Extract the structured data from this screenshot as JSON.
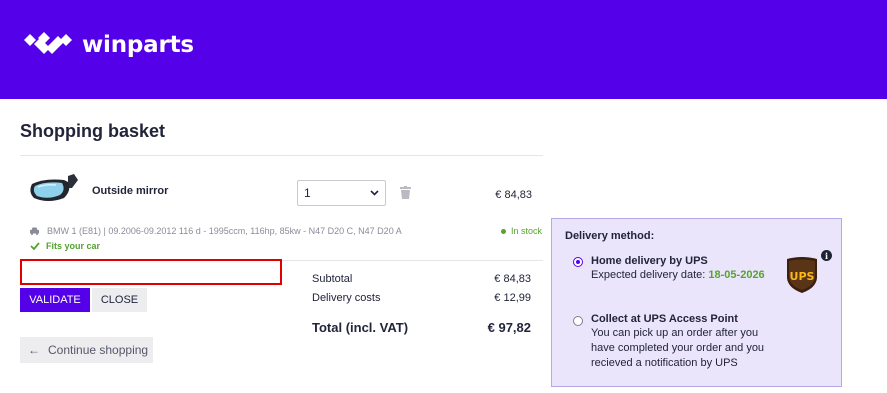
{
  "brand": {
    "name": "winparts",
    "accent": "#5400e8"
  },
  "page_title": "Shopping basket",
  "basket": {
    "item": {
      "name": "Outside mirror",
      "quantity": "1",
      "price": "€ 84,83",
      "vehicle": "BMW 1 (E81) | 09.2006-09.2012 116 d - 1995ccm, 116hp, 85kw - N47 D20 C, N47 D20 A",
      "fits": "Fits your car",
      "stock": "In stock"
    },
    "voucher": {
      "value": "",
      "placeholder": ""
    },
    "validate_label": "VALIDATE",
    "close_label": "CLOSE",
    "continue_label": "Continue shopping"
  },
  "summary": {
    "subtotal_label": "Subtotal",
    "subtotal_value": "€ 84,83",
    "delivery_label": "Delivery costs",
    "delivery_value": "€ 12,99",
    "total_label": "Total (incl. VAT)",
    "total_value": "€ 97,82"
  },
  "delivery": {
    "title": "Delivery method:",
    "options": [
      {
        "title": "Home delivery by UPS",
        "date_prefix": "Expected delivery date: ",
        "date": "18-05-2026",
        "selected": true
      },
      {
        "title": "Collect at UPS Access Point",
        "lines": [
          "You can pick up an order after you",
          "have completed your order and you",
          "recieved a notification by UPS"
        ],
        "selected": false
      }
    ],
    "carrier_logo": "UPS",
    "info_icon": "i"
  },
  "icons": {
    "logo": "winparts-logo-icon",
    "trash": "trash-icon",
    "car": "car-icon",
    "check": "check-icon",
    "arrow": "arrow-left-icon",
    "chevron": "chevron-down-icon"
  },
  "colors": {
    "header": "#5400e8",
    "green": "#55a330",
    "delivery_bg": "#ebe5fb",
    "highlight": "#e00000"
  }
}
